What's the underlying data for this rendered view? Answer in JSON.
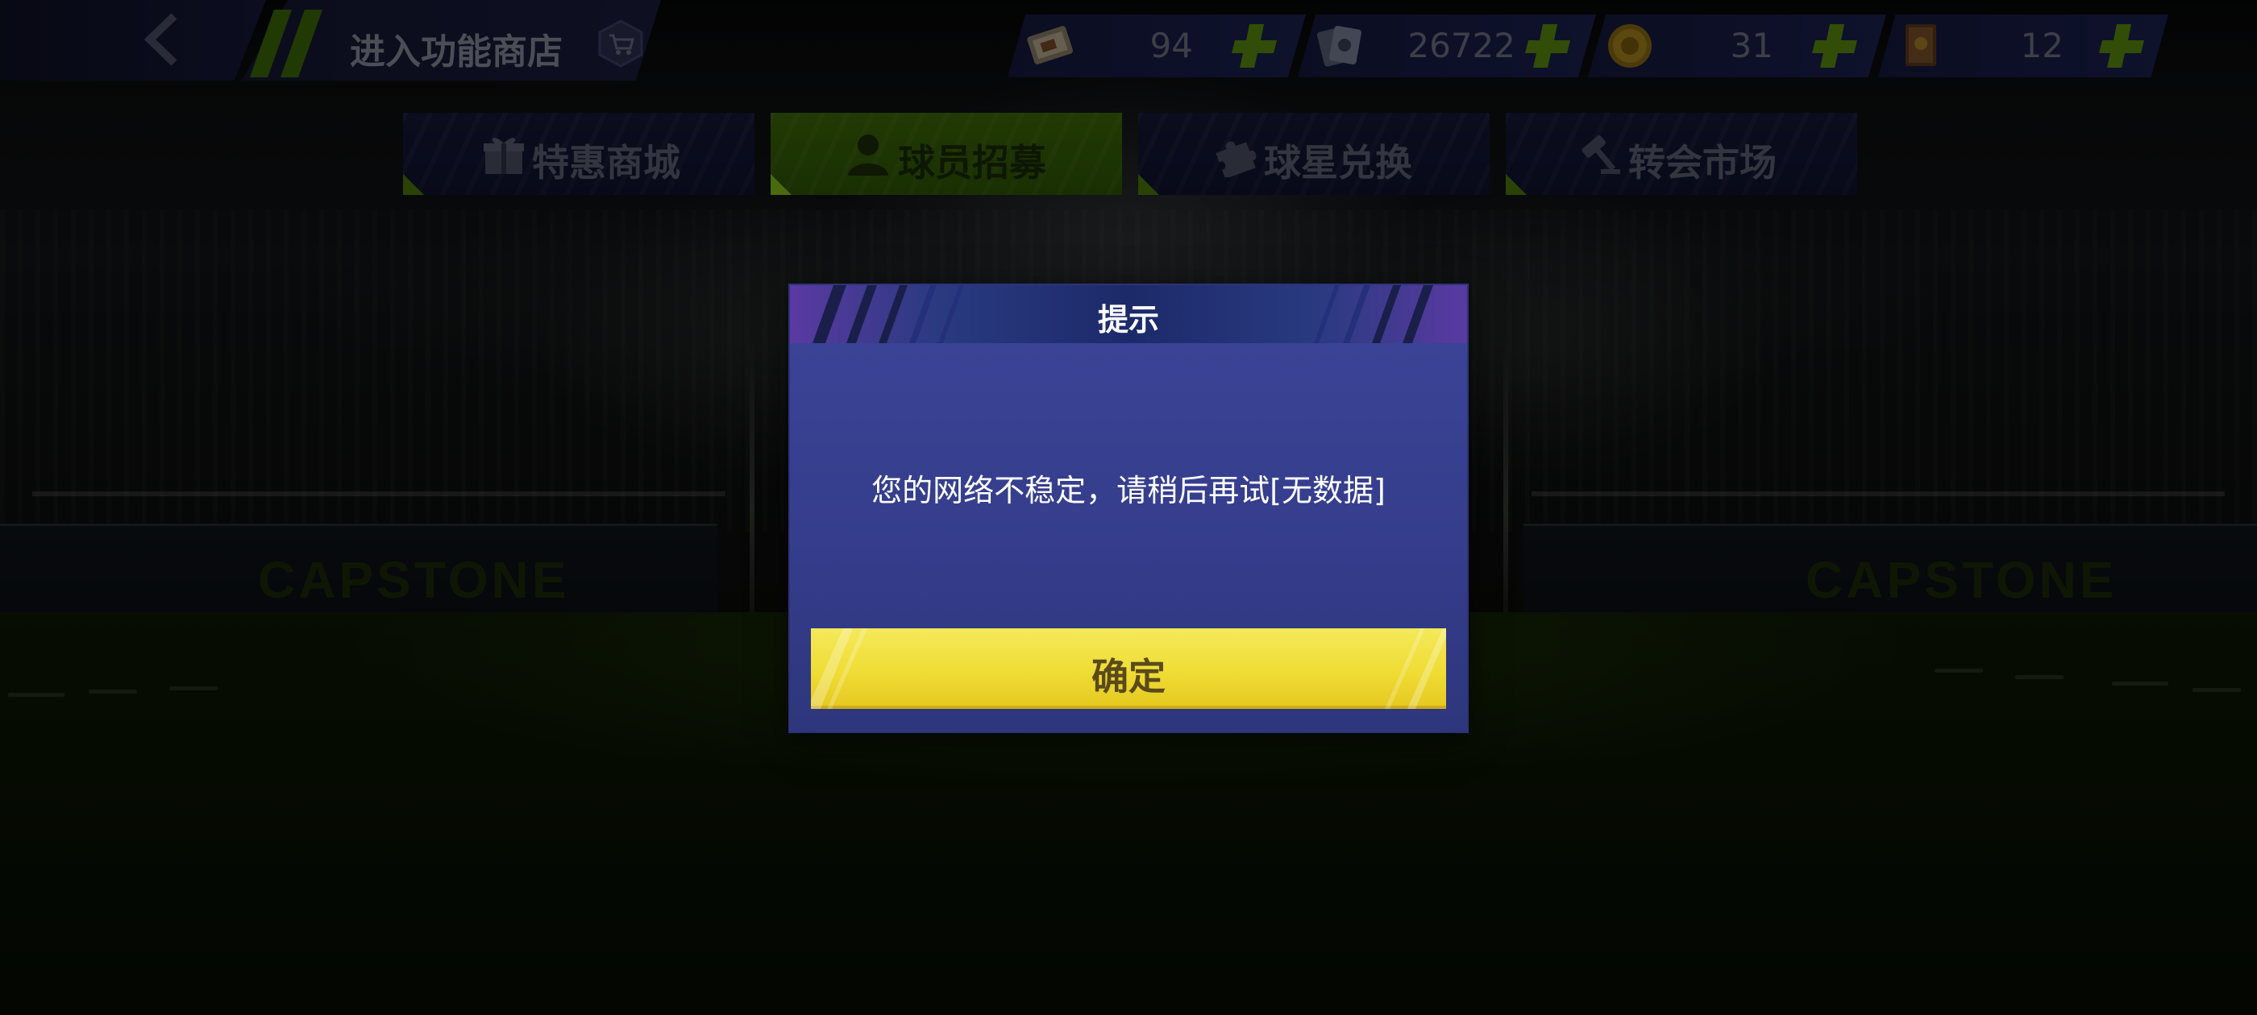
{
  "header": {
    "back_label": "",
    "title": "进入功能商店"
  },
  "resources": [
    {
      "name": "ticket-icon",
      "value": "94"
    },
    {
      "name": "card-pack-icon",
      "value": "26722"
    },
    {
      "name": "gold-coin-icon",
      "value": "31"
    },
    {
      "name": "book-icon",
      "value": "12"
    }
  ],
  "tabs": [
    {
      "label": "特惠商城",
      "icon": "gift-icon",
      "active": false
    },
    {
      "label": "球员招募",
      "icon": "person-icon",
      "active": true
    },
    {
      "label": "球星兑换",
      "icon": "puzzle-icon",
      "active": false
    },
    {
      "label": "转会市场",
      "icon": "gavel-icon",
      "active": false
    }
  ],
  "background": {
    "board_left": "CAPSTONE",
    "board_right": "CAPSTONE"
  },
  "dialog": {
    "title": "提示",
    "message": "您的网络不稳定，请稍后再试[无数据]",
    "confirm_label": "确定"
  },
  "colors": {
    "accent_green": "#7dbb14",
    "dialog_bg": "#353d8a",
    "confirm_yellow": "#efdc34"
  }
}
